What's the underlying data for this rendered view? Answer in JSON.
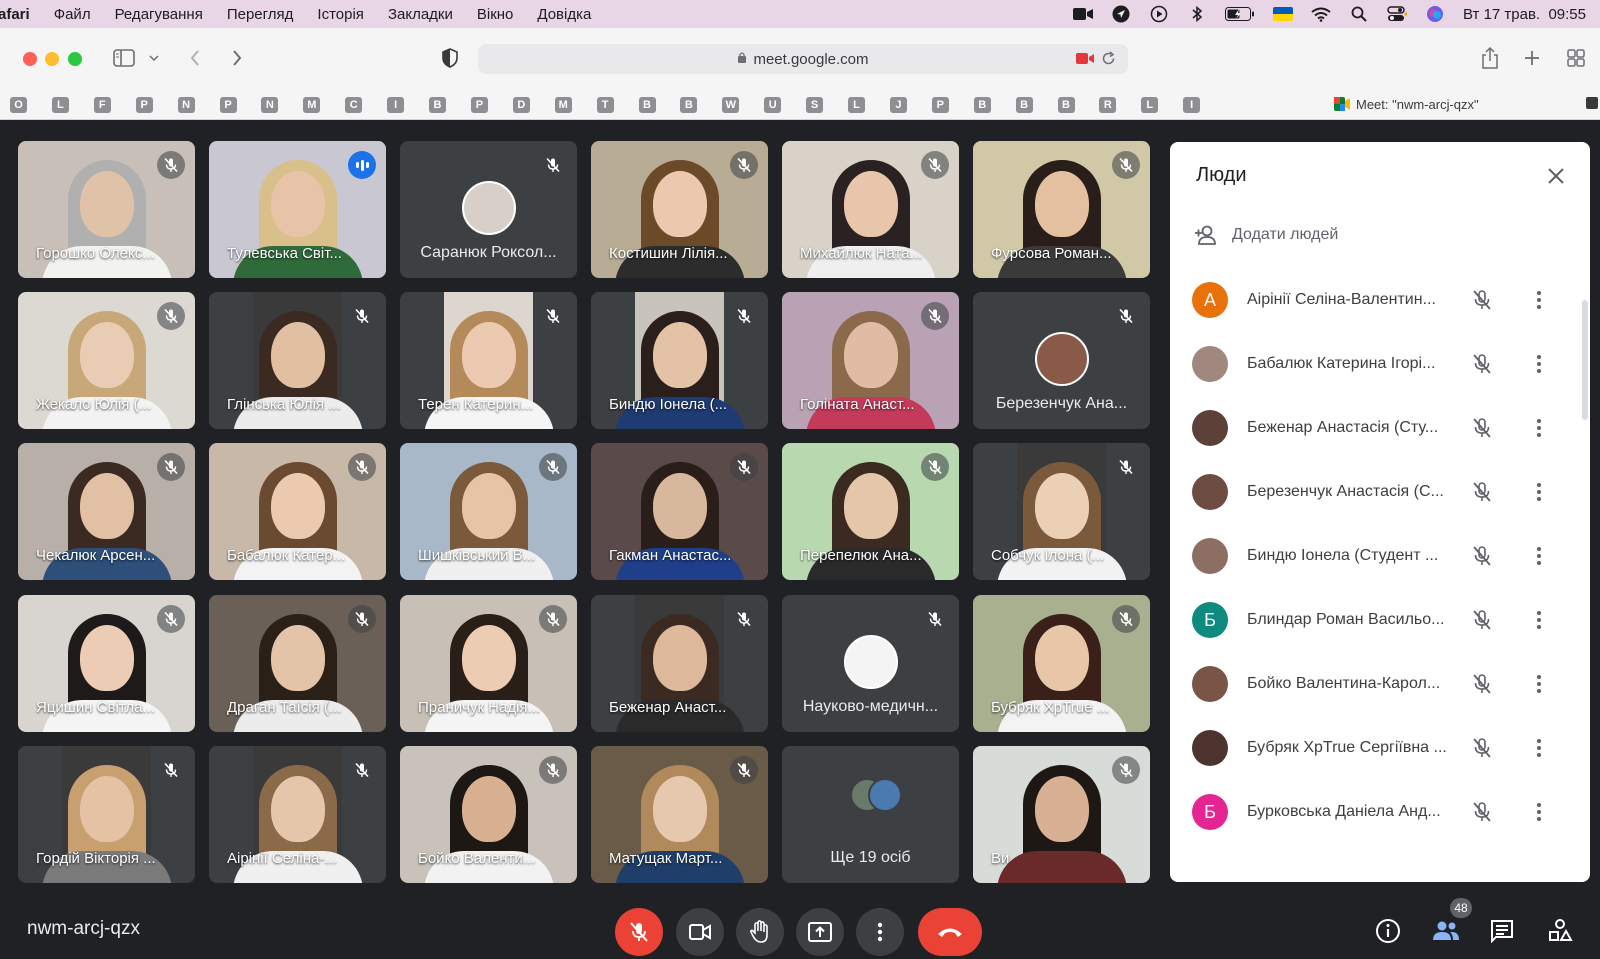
{
  "menubar": {
    "app": "afari",
    "items": [
      "Файл",
      "Редагування",
      "Перегляд",
      "Історія",
      "Закладки",
      "Вікно",
      "Довідка"
    ],
    "clock": "Вт 17 трав.  09:55"
  },
  "browser": {
    "url": "meet.google.com",
    "tab_title": "Meet: \"nwm-arcj-qzx\"",
    "bookmarks": [
      "O",
      "L",
      "F",
      "P",
      "N",
      "P",
      "N",
      "M",
      "C",
      "I",
      "B",
      "P",
      "D",
      "M",
      "T",
      "B",
      "B",
      "W",
      "U",
      "S",
      "L",
      "J",
      "P",
      "B",
      "B",
      "B",
      "R",
      "L",
      "I"
    ]
  },
  "tiles": [
    {
      "name": "Горошко Олекс...",
      "state": "muted"
    },
    {
      "name": "Тулевська Світ...",
      "state": "speaking"
    },
    {
      "name": "Саранюк Роксол...",
      "state": "muted"
    },
    {
      "name": "Костишин Лілія...",
      "state": "muted"
    },
    {
      "name": "Михайлюк Ната...",
      "state": "muted"
    },
    {
      "name": "Фурсова Роман...",
      "state": "muted"
    },
    {
      "name": "Жекало Юлія (...",
      "state": "muted"
    },
    {
      "name": "Глінська Юлія ...",
      "state": "muted"
    },
    {
      "name": "Терен Катерин...",
      "state": "muted"
    },
    {
      "name": "Биндю Іонела (...",
      "state": "muted"
    },
    {
      "name": "Голіната Анаст...",
      "state": "muted"
    },
    {
      "name": "Березенчук Ана...",
      "state": "muted"
    },
    {
      "name": "Чекалюк Арсен...",
      "state": "muted"
    },
    {
      "name": "Бабалюк Катер...",
      "state": "muted"
    },
    {
      "name": "Шишківський В...",
      "state": "muted"
    },
    {
      "name": "Гакман Анастас...",
      "state": "muted"
    },
    {
      "name": "Перепелюк Ана...",
      "state": "muted"
    },
    {
      "name": "Собчук Ілона (...",
      "state": "muted"
    },
    {
      "name": "Яцишин Світла...",
      "state": "muted"
    },
    {
      "name": "Драган Таїсія (...",
      "state": "muted"
    },
    {
      "name": "Праничук Надія...",
      "state": "muted"
    },
    {
      "name": "Беженар Анаст...",
      "state": "muted"
    },
    {
      "name": "Науково-медичн...",
      "state": "muted"
    },
    {
      "name": "Бубряк ХрTrue ...",
      "state": "muted"
    },
    {
      "name": "Гордій Вікторія ...",
      "state": "muted"
    },
    {
      "name": "Аірінії Селіна-...",
      "state": "muted"
    },
    {
      "name": "Бойко Валенти...",
      "state": "muted"
    },
    {
      "name": "Матущак Март...",
      "state": "muted"
    },
    {
      "name": "Ще 19 осіб",
      "state": "more"
    },
    {
      "name": "Ви",
      "state": "muted"
    }
  ],
  "panel": {
    "title": "Люди",
    "add_people": "Додати людей",
    "people": [
      {
        "name": "Аірінії Селіна-Валентин...",
        "initial": "А",
        "color": "#e8710a"
      },
      {
        "name": "Бабалюк Катерина Ігорі...",
        "initial": "",
        "color": "#a1887f"
      },
      {
        "name": "Беженар Анастасія (Сту...",
        "initial": "",
        "color": "#5d4037"
      },
      {
        "name": "Березенчук Анастасія (С...",
        "initial": "",
        "color": "#6d4c41"
      },
      {
        "name": "Биндю Іонела (Студент ...",
        "initial": "",
        "color": "#8d6e63"
      },
      {
        "name": "Блиндар Роман Васильо...",
        "initial": "Б",
        "color": "#0f8a7e"
      },
      {
        "name": "Бойко Валентина-Карол...",
        "initial": "",
        "color": "#795548"
      },
      {
        "name": "Бубряк ХрTrue Сергіївна ...",
        "initial": "",
        "color": "#4e342e"
      },
      {
        "name": "Бурковська Даніела Анд...",
        "initial": "Б",
        "color": "#e52592"
      }
    ]
  },
  "bottom": {
    "meeting_code": "nwm-arcj-qzx",
    "people_count": "48"
  }
}
